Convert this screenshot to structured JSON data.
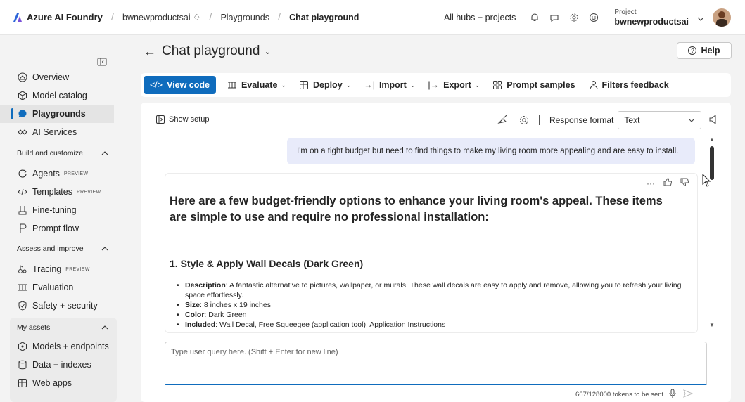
{
  "topbar": {
    "brand": "Azure AI Foundry",
    "breadcrumbs": [
      "bwnewproductsai ♢",
      "Playgrounds",
      "Chat playground"
    ],
    "hubs_label": "All hubs + projects",
    "project_label": "Project",
    "project_name": "bwnewproductsai",
    "icons": [
      "bell-icon",
      "feedback-icon",
      "gear-icon",
      "smiley-icon",
      "chevron-down-icon",
      "avatar"
    ]
  },
  "sidebar": {
    "items_top": [
      {
        "label": "Overview",
        "icon": "home-icon"
      },
      {
        "label": "Model catalog",
        "icon": "cube-icon"
      },
      {
        "label": "Playgrounds",
        "icon": "chat-icon",
        "active": true
      },
      {
        "label": "AI Services",
        "icon": "services-icon"
      }
    ],
    "section_build": "Build and customize",
    "items_build": [
      {
        "label": "Agents",
        "tag": "PREVIEW",
        "icon": "agent-icon"
      },
      {
        "label": "Templates",
        "tag": "PREVIEW",
        "icon": "code-icon"
      },
      {
        "label": "Fine-tuning",
        "icon": "tune-icon"
      },
      {
        "label": "Prompt flow",
        "icon": "flow-icon"
      }
    ],
    "section_assess": "Assess and improve",
    "items_assess": [
      {
        "label": "Tracing",
        "tag": "PREVIEW",
        "icon": "trace-icon"
      },
      {
        "label": "Evaluation",
        "icon": "evaluation-icon"
      },
      {
        "label": "Safety + security",
        "icon": "shield-icon"
      }
    ],
    "section_assets": "My assets",
    "items_assets": [
      {
        "label": "Models + endpoints",
        "icon": "model-icon"
      },
      {
        "label": "Data + indexes",
        "icon": "database-icon"
      },
      {
        "label": "Web apps",
        "icon": "webapp-icon"
      }
    ]
  },
  "main": {
    "title": "Chat playground",
    "help": "Help",
    "toolbar": {
      "view_code": "View code",
      "evaluate": "Evaluate",
      "deploy": "Deploy",
      "import": "Import",
      "export": "Export",
      "prompt_samples": "Prompt samples",
      "filters_feedback": "Filters feedback"
    }
  },
  "chat": {
    "show_setup": "Show setup",
    "response_format_label": "Response format",
    "response_format_value": "Text",
    "user_message": "I'm on a tight budget but need to find things to make my living room more appealing and are easy to install.",
    "response_heading": "Here are a few budget-friendly options to enhance your living room's appeal. These items are simple to use and require no professional installation:",
    "section_title": "1. Style & Apply Wall Decals (Dark Green)",
    "bullets": [
      {
        "key": "Description",
        "text": ": A fantastic alternative to pictures, wallpaper, or murals. These wall decals are easy to apply and remove, allowing you to refresh your living space effortlessly."
      },
      {
        "key": "Size",
        "text": ": 8 inches x 19 inches"
      },
      {
        "key": "Color",
        "text": ": Dark Green"
      },
      {
        "key": "Included",
        "text": ": Wall Decal, Free Squeegee (application tool), Application Instructions"
      }
    ],
    "input_placeholder": "Type user query here. (Shift + Enter for new line)",
    "tokens": "667/128000 tokens to be sent"
  }
}
